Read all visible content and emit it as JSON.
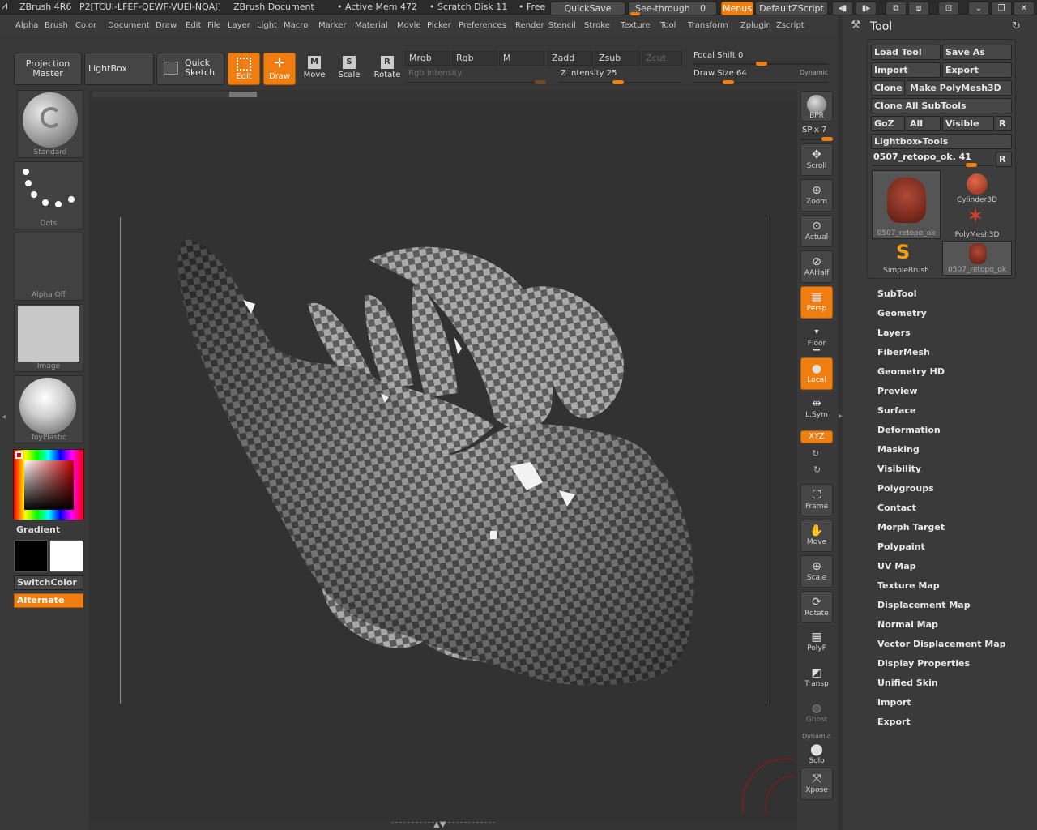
{
  "titlebar": {
    "app": "ZBrush 4R6",
    "doc_id": "P2[TCUI-LFEF-QEWF-VUEI-NQAJ]",
    "doc": "ZBrush Document",
    "mem": "• Active Mem 472",
    "scratch": "• Scratch Disk 11",
    "free": "• Free",
    "quicksave": "QuickSave",
    "seethrough": "See-through",
    "seethrough_val": "0",
    "menus": "Menus",
    "script": "DefaultZScript"
  },
  "menubar": [
    "Alpha",
    "Brush",
    "Color",
    "Document",
    "Draw",
    "Edit",
    "File",
    "Layer",
    "Light",
    "Macro",
    "Marker",
    "Material",
    "Movie",
    "Picker",
    "Preferences",
    "Render",
    "Stencil",
    "Stroke",
    "Texture",
    "Tool",
    "Transform",
    "Zplugin",
    "Zscript"
  ],
  "toolbar": {
    "projection_master": "Projection Master",
    "lightbox": "LightBox",
    "quick_sketch": "Quick Sketch",
    "edit": "Edit",
    "draw": "Draw",
    "move": "Move",
    "scale": "Scale",
    "rotate": "Rotate",
    "mrgb": "Mrgb",
    "rgb": "Rgb",
    "m": "M",
    "zadd": "Zadd",
    "zsub": "Zsub",
    "zcut": "Zcut",
    "rgb_intensity": "Rgb Intensity",
    "z_intensity": "Z Intensity",
    "z_intensity_val": "25",
    "focal_shift": "Focal Shift",
    "focal_shift_val": "0",
    "draw_size": "Draw Size",
    "draw_size_val": "64",
    "dynamic": "Dynamic"
  },
  "leftshelf": {
    "brush": "Standard",
    "stroke": "Dots",
    "alpha": "Alpha Off",
    "texture": "Image",
    "material": "ToyPlastic",
    "gradient": "Gradient",
    "switchcolor": "SwitchColor",
    "alternate": "Alternate"
  },
  "rightshelf": {
    "bpr": "BPR",
    "spix": "SPix",
    "spix_val": "7",
    "scroll": "Scroll",
    "zoom": "Zoom",
    "actual": "Actual",
    "aahalf": "AAHalf",
    "persp": "Persp",
    "floor": "Floor",
    "local": "Local",
    "lsym": "L.Sym",
    "xyz": "XYZ",
    "frame": "Frame",
    "move": "Move",
    "scale": "Scale",
    "rotate": "Rotate",
    "polyf": "PolyF",
    "transp": "Transp",
    "ghost": "Ghost",
    "dynamic": "Dynamic",
    "solo": "Solo",
    "xpose": "Xpose"
  },
  "toolpanel": {
    "title": "Tool",
    "load_tool": "Load Tool",
    "save_as": "Save As",
    "import": "Import",
    "export": "Export",
    "clone": "Clone",
    "make_polymesh": "Make PolyMesh3D",
    "clone_all": "Clone All SubTools",
    "goz": "GoZ",
    "all": "All",
    "visible": "Visible",
    "r": "R",
    "lightbox_tools": "Lightbox▸Tools",
    "current_tool": "0507_retopo_ok.",
    "current_tool_val": "41",
    "tools": [
      {
        "label": "0507_retopo_ok"
      },
      {
        "label": "Cylinder3D"
      },
      {
        "label": "PolyMesh3D"
      },
      {
        "label": "SimpleBrush"
      },
      {
        "label": "0507_retopo_ok"
      }
    ],
    "menu": [
      "SubTool",
      "Geometry",
      "Layers",
      "FiberMesh",
      "Geometry HD",
      "Preview",
      "Surface",
      "Deformation",
      "Masking",
      "Visibility",
      "Polygroups",
      "Contact",
      "Morph Target",
      "Polypaint",
      "UV Map",
      "Texture Map",
      "Displacement Map",
      "Normal Map",
      "Vector Displacement Map",
      "Display Properties",
      "Unified Skin",
      "Import",
      "Export"
    ]
  },
  "colors": {
    "accent": "#f07d10",
    "bg": "#3a3a3a",
    "canvas": "#323232"
  }
}
